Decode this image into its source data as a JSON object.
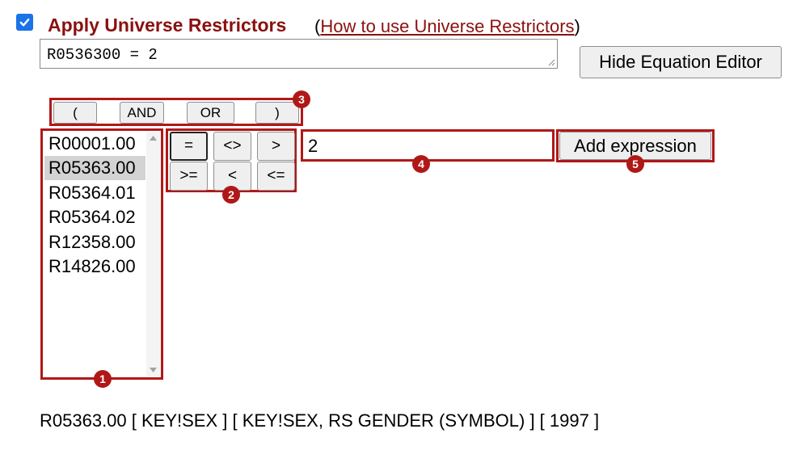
{
  "restrictors": {
    "checkbox_checked": true,
    "title": "Apply Universe Restrictors",
    "help_prefix": "(",
    "help_link": "How to use Universe Restrictors",
    "help_suffix": ")"
  },
  "equation": {
    "value": "R0536300 = 2",
    "hide_button_label": "Hide Equation Editor"
  },
  "logic_buttons": [
    "(",
    "AND",
    "OR",
    ")"
  ],
  "variables": [
    "R00001.00",
    "R05363.00",
    "R05364.01",
    "R05364.02",
    "R12358.00",
    "R14826.00"
  ],
  "selected_variable": "R05363.00",
  "operators": [
    "=",
    "<>",
    ">",
    ">=",
    "<",
    "<="
  ],
  "selected_operator": "=",
  "value_input": "2",
  "add_button_label": "Add expression",
  "callouts": [
    "1",
    "2",
    "3",
    "4",
    "5"
  ],
  "variable_info": "R05363.00 [ KEY!SEX ] [ KEY!SEX, RS GENDER (SYMBOL) ] [ 1997 ]",
  "colors": {
    "accent_red": "#8b1010",
    "highlight_border": "#b01818",
    "checkbox_blue": "#1a73e8"
  }
}
